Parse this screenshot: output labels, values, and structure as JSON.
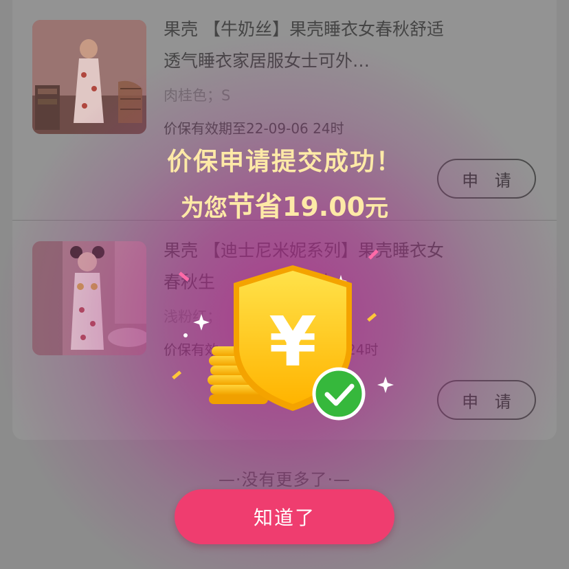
{
  "products": [
    {
      "title": "果壳  【牛奶丝】果壳睡衣女春秋舒适透气睡衣家居服女士可外…",
      "spec": "肉桂色；S",
      "validity": "价保有效期至22-09-06 24时",
      "apply_label": "申 请"
    },
    {
      "title": "果壳  【迪士尼米妮系列】果壳睡衣女春秋生 　 　 舒适女士…",
      "spec": "浅粉红；",
      "validity": "价保有效",
      "validity_tail": "24时",
      "apply_label": "申 请"
    }
  ],
  "list_footer": "—·没有更多了·—",
  "modal": {
    "title": "价保申请提交成功！",
    "saving_prefix": "为您",
    "saving_highlight": "节省",
    "saving_amount": "19.00",
    "saving_unit": "元",
    "currency_symbol": "¥",
    "confirm_label": "知道了",
    "icons": [
      "yuan-shield-icon",
      "coin-stack-icon",
      "check-badge-icon",
      "sparkle-icon"
    ]
  },
  "colors": {
    "accent": "#ef3d6f",
    "modal_text": "#fde9a7",
    "overlay_glow": "#af238c",
    "check_green": "#36b83c",
    "shield_gold": "#ffd21f"
  }
}
